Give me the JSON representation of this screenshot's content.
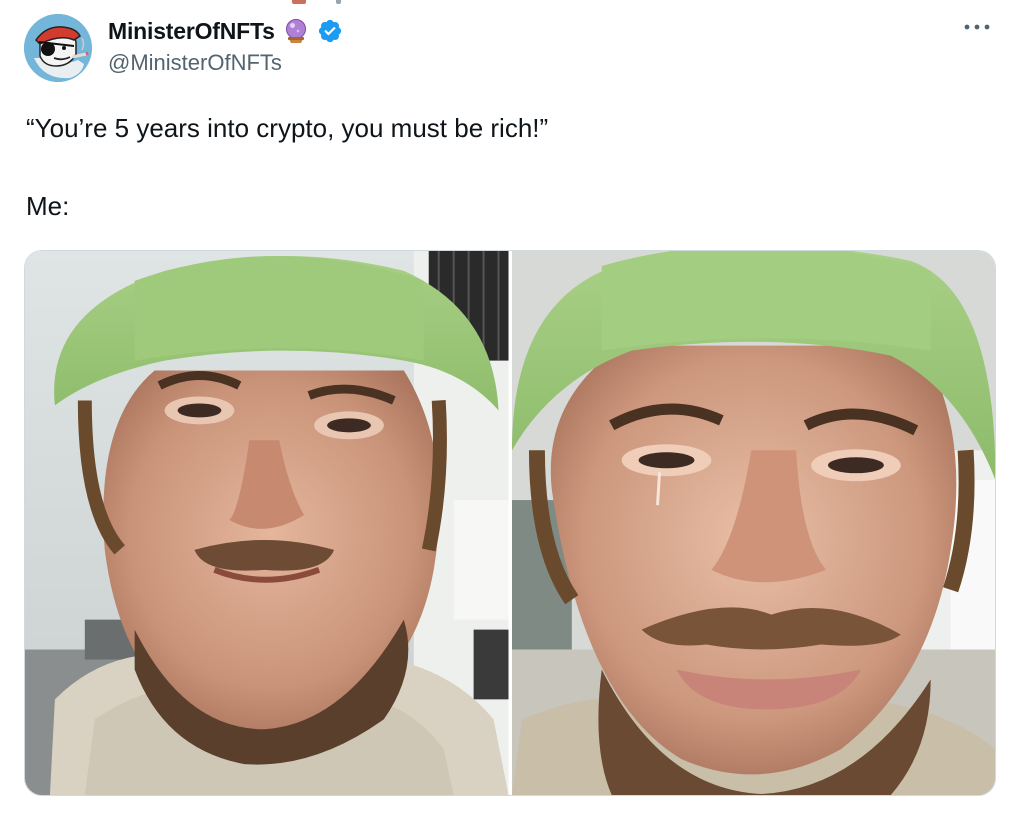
{
  "author": {
    "display_name": "MinisterOfNFTs",
    "handle": "@MinisterOfNFTs",
    "avatar_icon": "pirate-cartoon-avatar",
    "emoji_icon": "crystal-ball-icon",
    "verified_icon": "verified-badge-icon",
    "verified_color": "#1d9bf0"
  },
  "menu": {
    "icon": "more-options-icon"
  },
  "tweet": {
    "line1": "“You’re 5 years into crypto, you must be rich!”",
    "line2": "Me:"
  },
  "media": {
    "photos": [
      {
        "name": "photo-left",
        "description_icon": "crying-man-green-hat"
      },
      {
        "name": "photo-right",
        "description_icon": "crying-man-green-hat-closeup"
      }
    ]
  },
  "colors": {
    "text_primary": "#0f1419",
    "text_secondary": "#536471",
    "border": "#cfd9de"
  }
}
